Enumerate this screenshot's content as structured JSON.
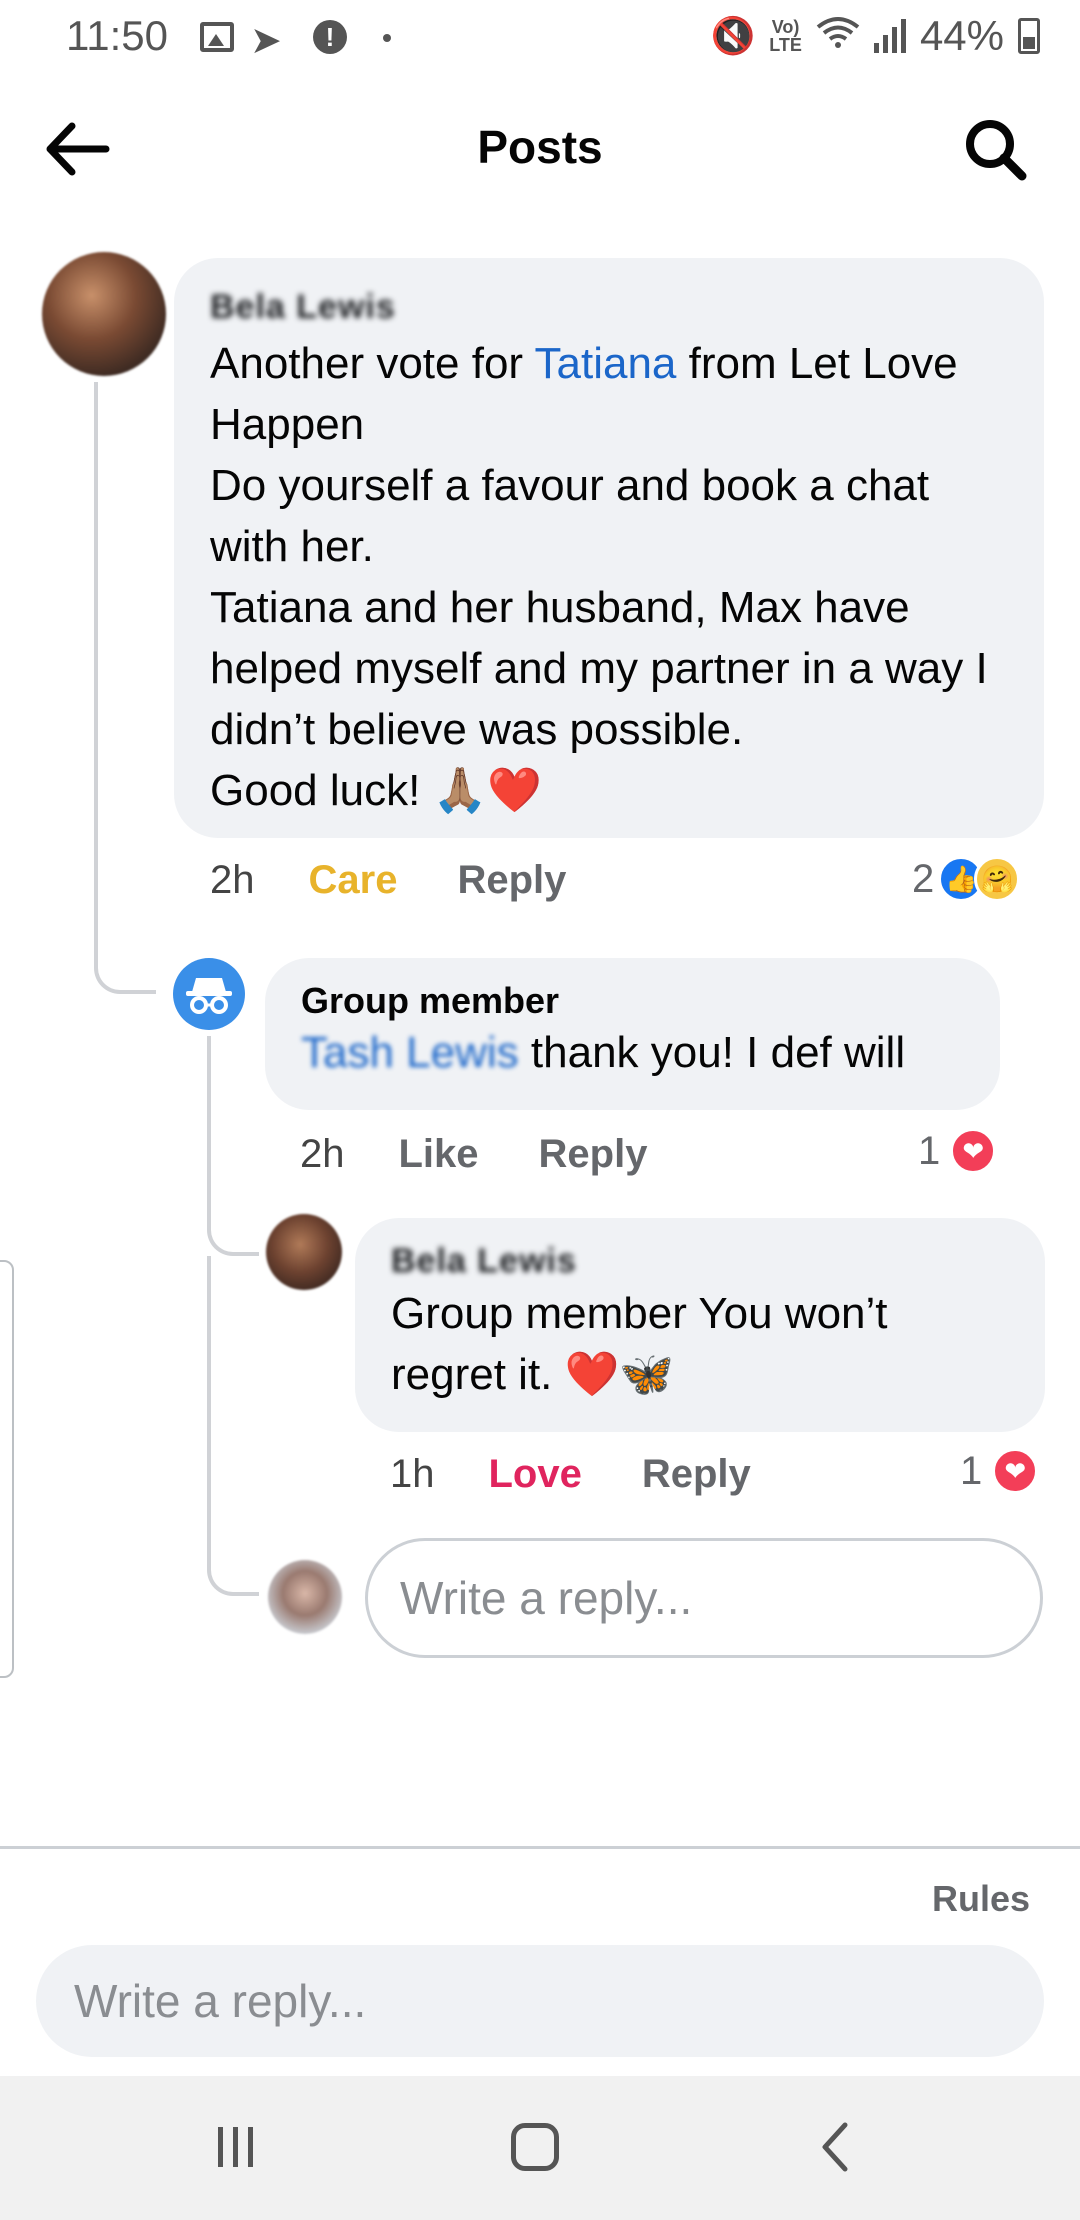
{
  "status_bar": {
    "time": "11:50",
    "battery": "44%",
    "network": "LTE",
    "network_label": "Vo)",
    "icons": [
      "image-icon",
      "telegram-icon",
      "alert-icon",
      "dot-icon",
      "mute-icon",
      "volte-icon",
      "wifi-icon",
      "signal-icon",
      "battery-icon"
    ]
  },
  "header": {
    "title": "Posts",
    "back_icon": "arrow-left-icon",
    "search_icon": "search-icon"
  },
  "comments": [
    {
      "author": "Bela Lewis",
      "text_before_mention": "Another vote for ",
      "mention": "Tatiana",
      "text_after_mention": " from Let Love Happen",
      "line_2": "Do yourself a favour and book a chat with her.",
      "line_3": "Tatiana and her husband, Max have helped myself and my partner in a way I didn’t believe was possible.",
      "line_4": "Good luck! 🙏🏽❤️",
      "time": "2h",
      "reaction_action": "Care",
      "reply_label": "Reply",
      "reaction_count": "2",
      "reactions": [
        "like-icon",
        "care-icon"
      ]
    },
    {
      "author": "Group member",
      "mention": "Tash Lewis",
      "text": " thank you! I def will",
      "time": "2h",
      "reaction_action": "Like",
      "reply_label": "Reply",
      "reaction_count": "1",
      "reactions": [
        "love-icon"
      ]
    },
    {
      "author": "Bela Lewis",
      "text": "Group member You won’t regret it. ❤️🦋",
      "time": "1h",
      "reaction_action": "Love",
      "reply_label": "Reply",
      "reaction_count": "1",
      "reactions": [
        "love-icon"
      ]
    }
  ],
  "reply_composer": {
    "placeholder": "Write a reply..."
  },
  "footer": {
    "rules_label": "Rules",
    "placeholder": "Write a reply..."
  },
  "colors": {
    "bubble": "#f0f2f5",
    "mention": "#1b66c9",
    "care": "#e8b32b",
    "love": "#e0245e",
    "like_reaction": "#1877f2"
  }
}
